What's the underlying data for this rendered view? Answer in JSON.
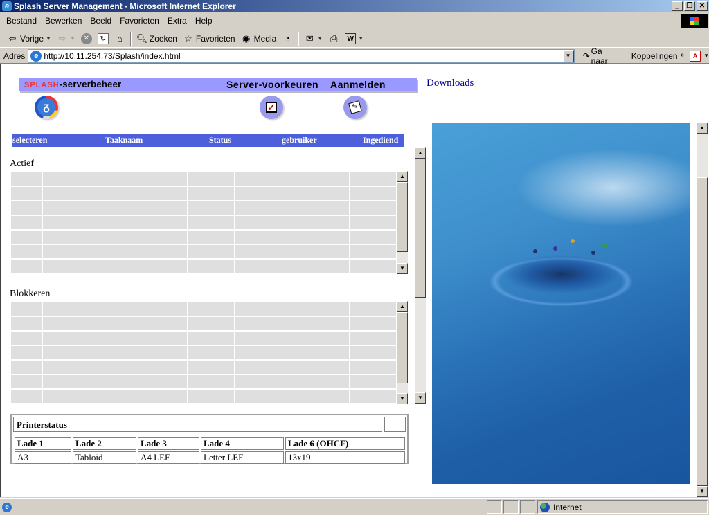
{
  "window": {
    "title": "Splash Server Management - Microsoft Internet Explorer",
    "buttons": {
      "minimize": "_",
      "maximize": "❐",
      "close": "✕"
    }
  },
  "menubar": [
    "Bestand",
    "Bewerken",
    "Beeld",
    "Favorieten",
    "Extra",
    "Help"
  ],
  "toolbar": {
    "back": "Vorige",
    "search": "Zoeken",
    "favorites": "Favorieten",
    "media": "Media"
  },
  "addressbar": {
    "label": "Adres",
    "url": "http://10.11.254.73/Splash/index.html",
    "go": "Ga naar",
    "links": "Koppelingen",
    "links_chevron": "»"
  },
  "page": {
    "brand_prefix": "SPLASH",
    "brand_suffix": "-serverbeheer",
    "nav": {
      "preferences": "Server-voorkeuren",
      "login": "Aanmelden",
      "downloads": "Downloads"
    },
    "columns": [
      "selecteren",
      "Taaknaam",
      "Status",
      "gebruiker",
      "Ingediend"
    ],
    "sections": {
      "active": {
        "title": "Actief",
        "rows": 7
      },
      "blocked": {
        "title": "Blokkeren",
        "rows": 7
      }
    },
    "printer_status": {
      "title": "Printerstatus",
      "headers": [
        "Lade 1",
        "Lade 2",
        "Lade 3",
        "Lade 4",
        "Lade 6 (OHCF)"
      ],
      "values": [
        "A3",
        "Tabloid",
        "A4 LEF",
        "Letter LEF",
        "13x19"
      ]
    }
  },
  "statusbar": {
    "zone": "Internet"
  },
  "colors": {
    "header_bar": "#9999ff",
    "column_header": "#4d5fdb",
    "brand_red": "#e33333",
    "grid_cell": "#dfdfdf",
    "link": "#00008b"
  }
}
